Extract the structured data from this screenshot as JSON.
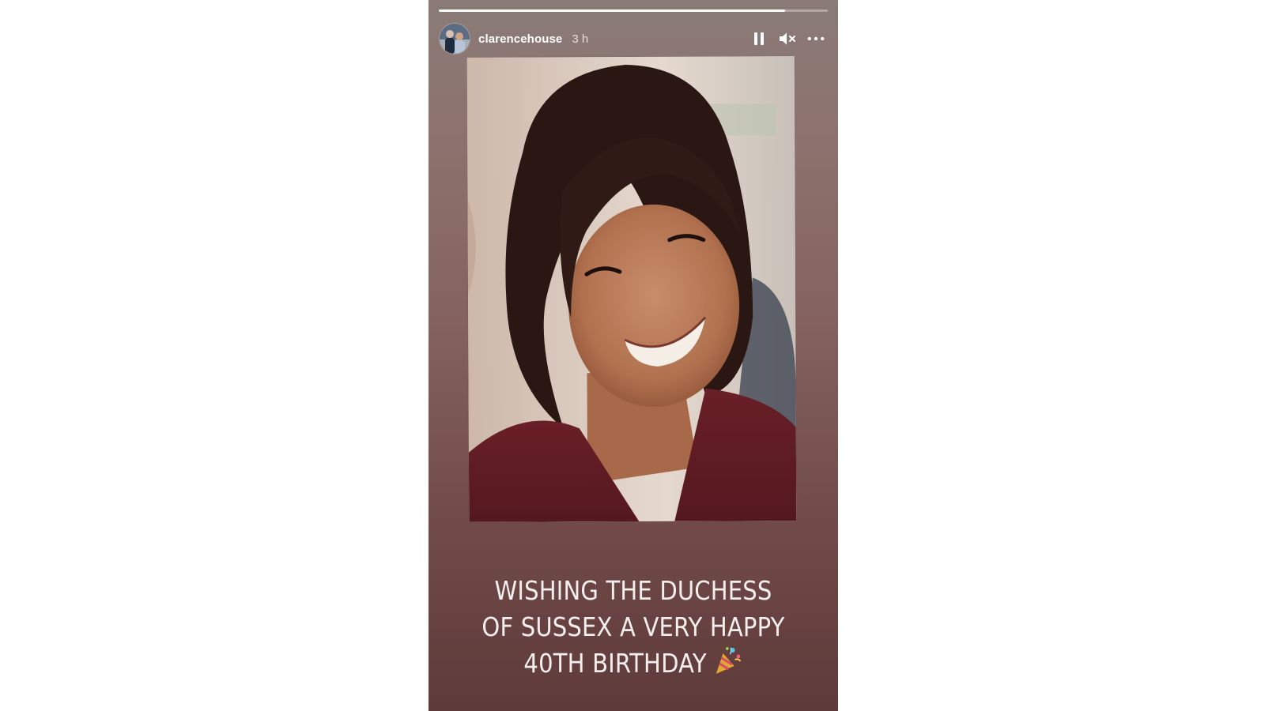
{
  "story": {
    "account_name": "clarencehouse",
    "time_ago": "3 h",
    "progress": 0.89,
    "controls": {
      "pause_icon": "pause-icon",
      "mute_icon": "mute-icon",
      "more_icon": "more-icon"
    },
    "caption": {
      "line1": "WISHING THE DUCHESS",
      "line2": "OF SUSSEX A VERY HAPPY",
      "line3": "40TH BIRTHDAY",
      "emoji_icon": "party-popper-icon"
    },
    "colors": {
      "background_top": "#8a7b77",
      "background_bottom": "#5e3a3a",
      "text": "#f4efee"
    }
  }
}
